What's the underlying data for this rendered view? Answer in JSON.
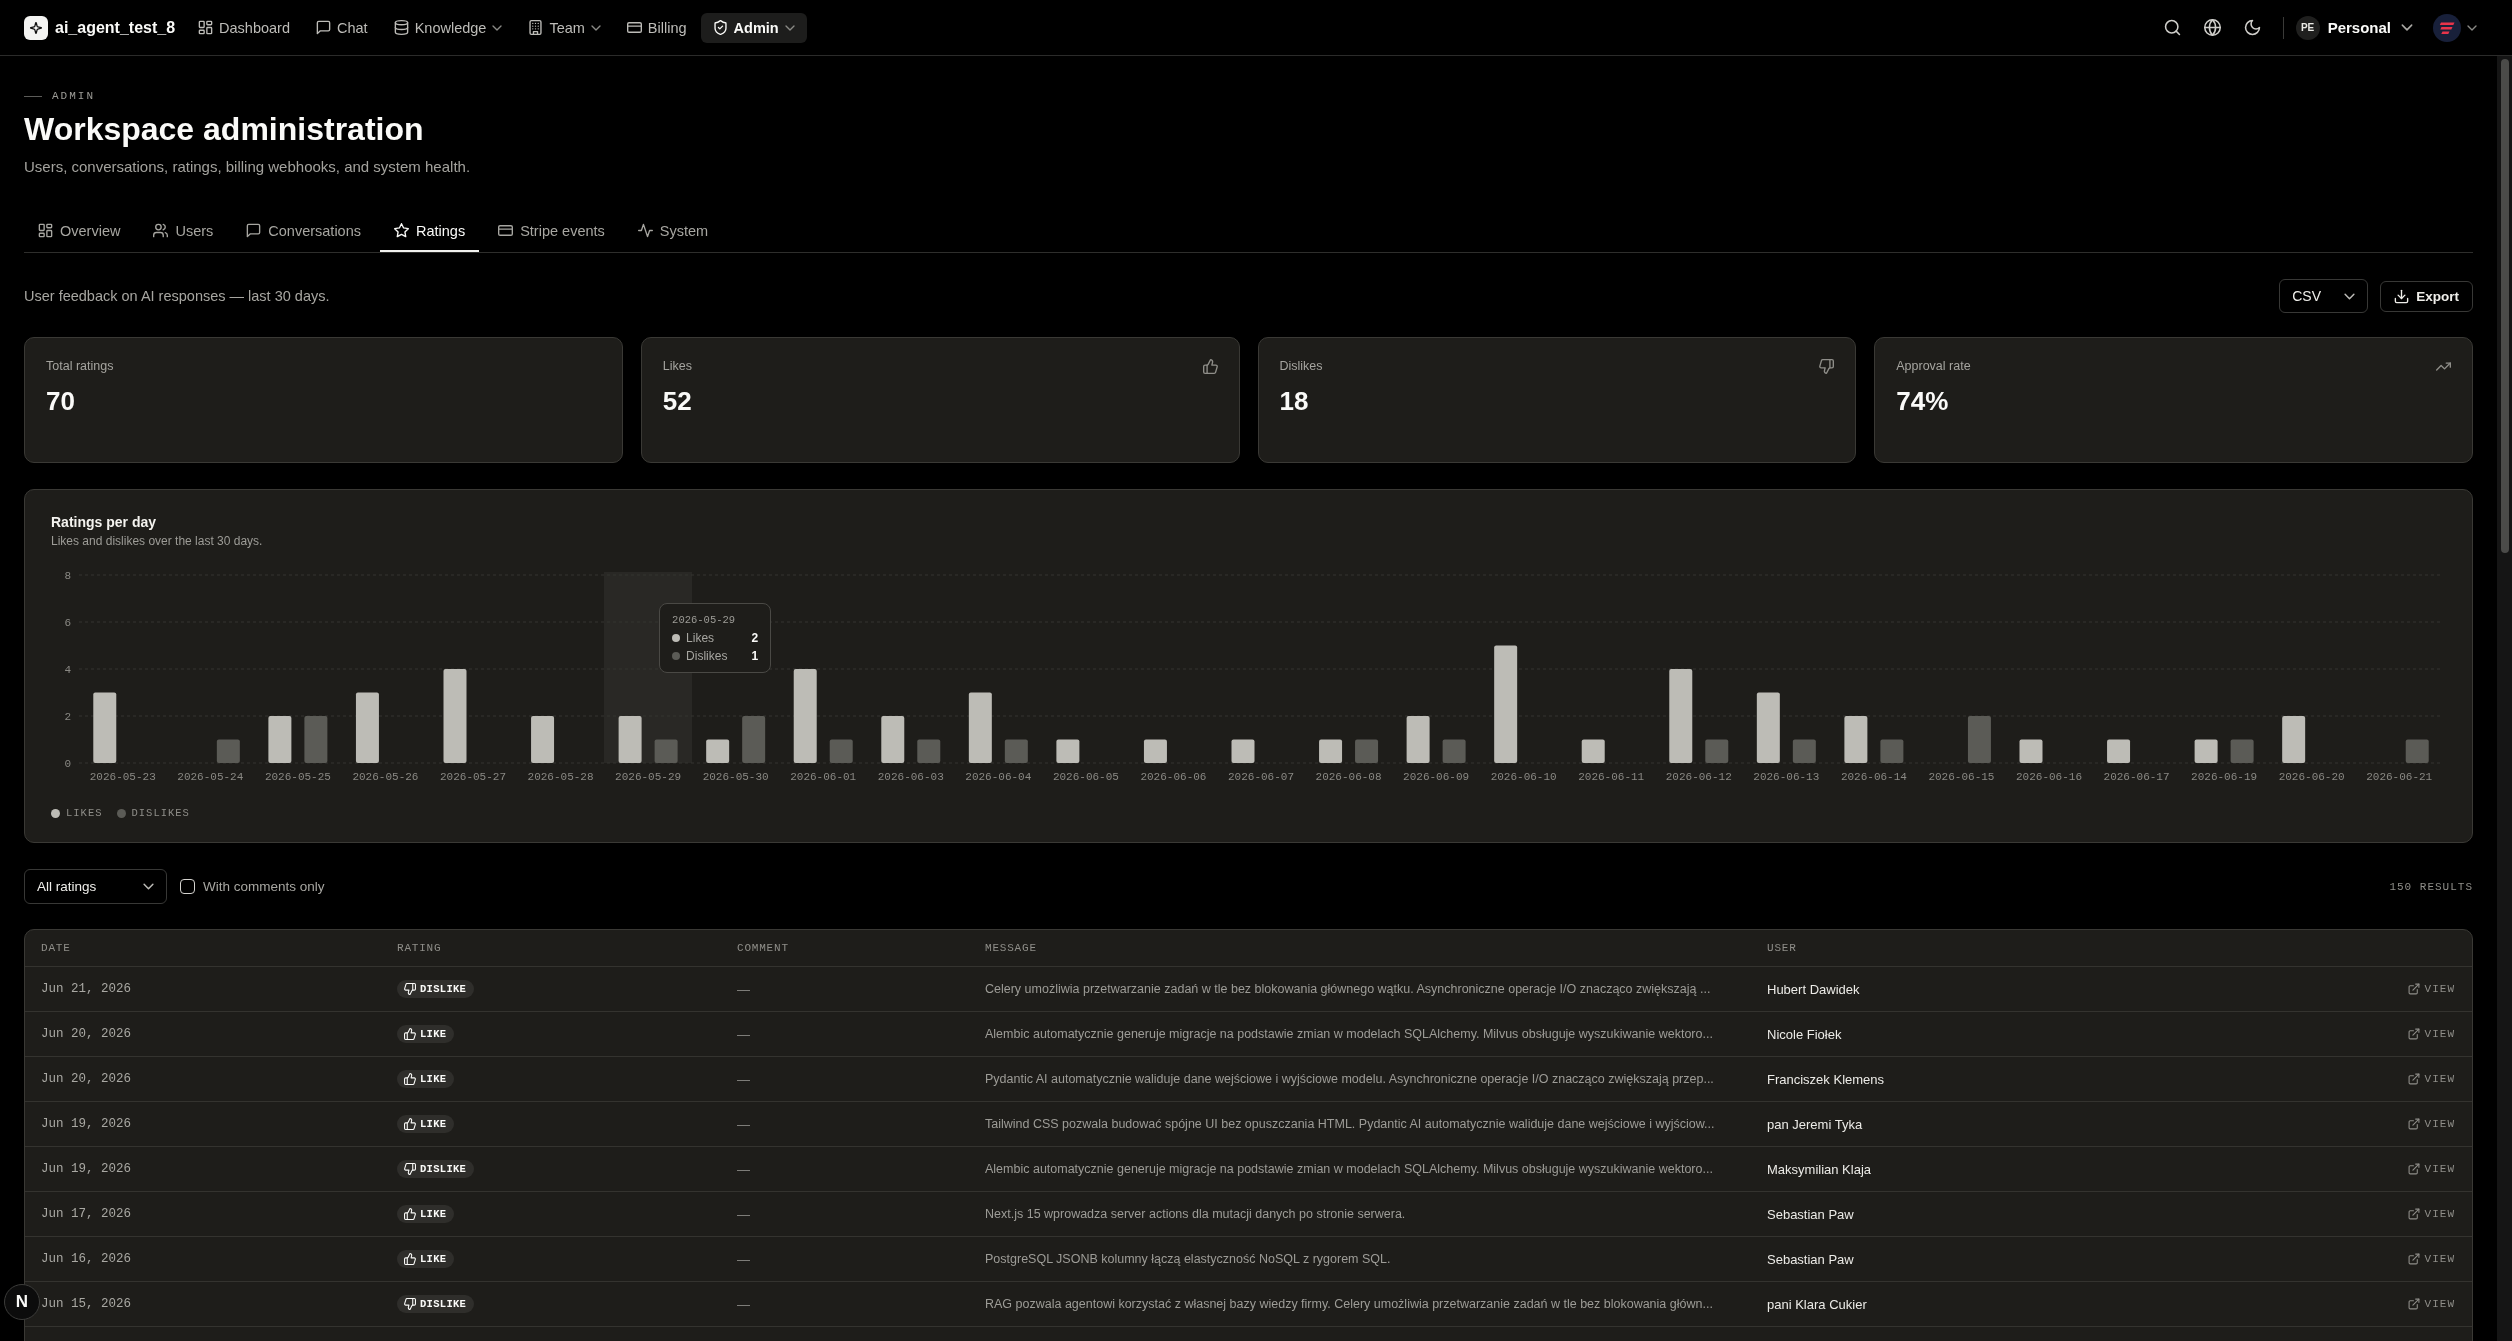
{
  "navbar": {
    "brand": "ai_agent_test_8",
    "items": [
      {
        "label": "Dashboard",
        "dropdown": false,
        "selected": false
      },
      {
        "label": "Chat",
        "dropdown": false,
        "selected": false
      },
      {
        "label": "Knowledge",
        "dropdown": true,
        "selected": false
      },
      {
        "label": "Team",
        "dropdown": true,
        "selected": false
      },
      {
        "label": "Billing",
        "dropdown": false,
        "selected": false
      },
      {
        "label": "Admin",
        "dropdown": true,
        "selected": true
      }
    ],
    "workspace": {
      "initials": "PE",
      "label": "Personal"
    }
  },
  "header": {
    "eyebrow": "ADMIN",
    "title": "Workspace administration",
    "subtitle": "Users, conversations, ratings, billing webhooks, and system health."
  },
  "tabs": [
    {
      "label": "Overview",
      "selected": false
    },
    {
      "label": "Users",
      "selected": false
    },
    {
      "label": "Conversations",
      "selected": false
    },
    {
      "label": "Ratings",
      "selected": true
    },
    {
      "label": "Stripe events",
      "selected": false
    },
    {
      "label": "System",
      "selected": false
    }
  ],
  "toolbar": {
    "description": "User feedback on AI responses — last 30 days.",
    "format_select": {
      "value": "CSV"
    },
    "export_button": {
      "label": "Export"
    }
  },
  "stats": [
    {
      "label": "Total ratings",
      "value": "70"
    },
    {
      "label": "Likes",
      "value": "52"
    },
    {
      "label": "Dislikes",
      "value": "18"
    },
    {
      "label": "Approval rate",
      "value": "74%"
    }
  ],
  "chart": {
    "subtitle": "Likes and dislikes over the last 30 days.",
    "chart_data": {
      "type": "bar",
      "title": "Ratings per day",
      "categories": [
        "2026-05-23",
        "2026-05-24",
        "2026-05-25",
        "2026-05-26",
        "2026-05-27",
        "2026-05-28",
        "2026-05-29",
        "2026-05-30",
        "2026-06-01",
        "2026-06-03",
        "2026-06-04",
        "2026-06-05",
        "2026-06-06",
        "2026-06-07",
        "2026-06-08",
        "2026-06-09",
        "2026-06-10",
        "2026-06-11",
        "2026-06-12",
        "2026-06-13",
        "2026-06-14",
        "2026-06-15",
        "2026-06-16",
        "2026-06-17",
        "2026-06-19",
        "2026-06-20",
        "2026-06-21"
      ],
      "series": [
        {
          "name": "Likes",
          "color": "#bdbcb6",
          "values": [
            3,
            0,
            2,
            3,
            4,
            2,
            2,
            1,
            4,
            2,
            3,
            1,
            1,
            1,
            1,
            2,
            5,
            1,
            4,
            3,
            2,
            0,
            1,
            1,
            1,
            2,
            0
          ]
        },
        {
          "name": "Dislikes",
          "color": "#5b5b56",
          "values": [
            0,
            1,
            2,
            0,
            0,
            0,
            1,
            2,
            1,
            1,
            1,
            0,
            0,
            0,
            1,
            1,
            0,
            0,
            1,
            1,
            1,
            2,
            0,
            0,
            1,
            0,
            1
          ]
        }
      ],
      "ylim": [
        0,
        8
      ],
      "yticks": [
        {
          "value": 0,
          "label": "0"
        },
        {
          "value": 2,
          "label": "2"
        },
        {
          "value": 4,
          "label": "4"
        },
        {
          "value": 6,
          "label": "6"
        },
        {
          "value": 8,
          "label": "8"
        }
      ],
      "grid": true
    },
    "legend": [
      {
        "label": "LIKES"
      },
      {
        "label": "DISLIKES"
      }
    ],
    "tooltip": {
      "title": "2026-05-29",
      "rows": [
        {
          "value": "2"
        },
        {
          "value": "1"
        }
      ]
    }
  },
  "filters": {
    "rating_select": {
      "value": "All ratings"
    },
    "comments_only": {
      "label": "With comments only",
      "checked": false
    },
    "result_count": "150 RESULTS"
  },
  "table": {
    "columns": [
      "DATE",
      "RATING",
      "COMMENT",
      "MESSAGE",
      "USER"
    ],
    "rows": [
      {
        "date": "Jun 21, 2026",
        "rating": {
          "kind": "dislike",
          "label": "DISLIKE"
        },
        "comment": "—",
        "message": "Celery umożliwia przetwarzanie zadań w tle bez blokowania głównego wątku. Asynchroniczne operacje I/O znacząco zwiększają ...",
        "user": "Hubert Dawidek",
        "action": "VIEW"
      },
      {
        "date": "Jun 20, 2026",
        "rating": {
          "kind": "like",
          "label": "LIKE"
        },
        "comment": "—",
        "message": "Alembic automatycznie generuje migracje na podstawie zmian w modelach SQLAlchemy. Milvus obsługuje wyszukiwanie wektoro...",
        "user": "Nicole Fiołek",
        "action": "VIEW"
      },
      {
        "date": "Jun 20, 2026",
        "rating": {
          "kind": "like",
          "label": "LIKE"
        },
        "comment": "—",
        "message": "Pydantic AI automatycznie waliduje dane wejściowe i wyjściowe modelu. Asynchroniczne operacje I/O znacząco zwiększają przep...",
        "user": "Franciszek Klemens",
        "action": "VIEW"
      },
      {
        "date": "Jun 19, 2026",
        "rating": {
          "kind": "like",
          "label": "LIKE"
        },
        "comment": "—",
        "message": "Tailwind CSS pozwala budować spójne UI bez opuszczania HTML. Pydantic AI automatycznie waliduje dane wejściowe i wyjściow...",
        "user": "pan Jeremi Tyka",
        "action": "VIEW"
      },
      {
        "date": "Jun 19, 2026",
        "rating": {
          "kind": "dislike",
          "label": "DISLIKE"
        },
        "comment": "—",
        "message": "Alembic automatycznie generuje migracje na podstawie zmian w modelach SQLAlchemy. Milvus obsługuje wyszukiwanie wektoro...",
        "user": "Maksymilian Klaja",
        "action": "VIEW"
      },
      {
        "date": "Jun 17, 2026",
        "rating": {
          "kind": "like",
          "label": "LIKE"
        },
        "comment": "—",
        "message": "Next.js 15 wprowadza server actions dla mutacji danych po stronie serwera.",
        "user": "Sebastian Paw",
        "action": "VIEW"
      },
      {
        "date": "Jun 16, 2026",
        "rating": {
          "kind": "like",
          "label": "LIKE"
        },
        "comment": "—",
        "message": "PostgreSQL JSONB kolumny łączą elastyczność NoSQL z rygorem SQL.",
        "user": "Sebastian Paw",
        "action": "VIEW"
      },
      {
        "date": "Jun 15, 2026",
        "rating": {
          "kind": "dislike",
          "label": "DISLIKE"
        },
        "comment": "—",
        "message": "RAG pozwala agentowi korzystać z własnej bazy wiedzy firmy. Celery umożliwia przetwarzanie zadań w tle bez blokowania główn...",
        "user": "pani Klara Cukier",
        "action": "VIEW"
      }
    ]
  },
  "dev_indicator": {
    "label": "N"
  }
}
